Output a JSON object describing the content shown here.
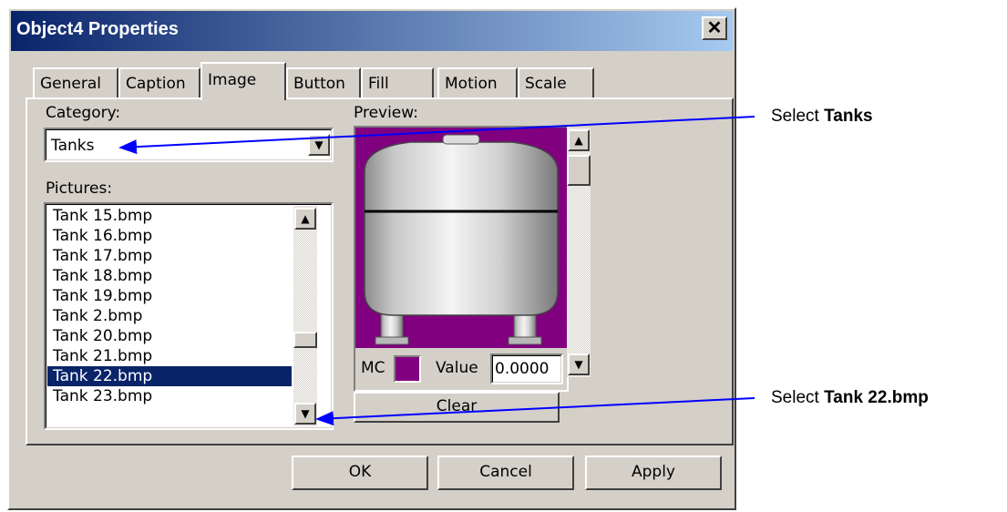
{
  "window": {
    "title": "Object4 Properties",
    "close_glyph": "✕"
  },
  "tabs": [
    {
      "label": "General"
    },
    {
      "label": "Caption"
    },
    {
      "label": "Image"
    },
    {
      "label": "Button"
    },
    {
      "label": "Fill"
    },
    {
      "label": "Motion"
    },
    {
      "label": "Scale"
    }
  ],
  "active_tab": "Image",
  "category": {
    "label": "Category:",
    "value": "Tanks"
  },
  "pictures": {
    "label": "Pictures:",
    "items": [
      "Tank 15.bmp",
      "Tank 16.bmp",
      "Tank 17.bmp",
      "Tank 18.bmp",
      "Tank 19.bmp",
      "Tank 2.bmp",
      "Tank 20.bmp",
      "Tank 21.bmp",
      "Tank 22.bmp",
      "Tank 23.bmp"
    ],
    "selected": "Tank 22.bmp"
  },
  "preview": {
    "label": "Preview:",
    "mc_label": "MC",
    "mc_color": "#800080",
    "value_label": "Value",
    "value": "0.0000",
    "clear_label": "Clear",
    "background_color": "#800080"
  },
  "buttons": {
    "ok": "OK",
    "cancel": "Cancel",
    "apply": "Apply"
  },
  "callouts": [
    {
      "prefix": "Select ",
      "bold": "Tanks"
    },
    {
      "prefix": "Select ",
      "bold": "Tank 22.bmp"
    }
  ],
  "colors": {
    "titlebar": "#0a246a",
    "selection": "#0a246a",
    "arrow": "#0000ff",
    "face": "#d4d0c8"
  }
}
